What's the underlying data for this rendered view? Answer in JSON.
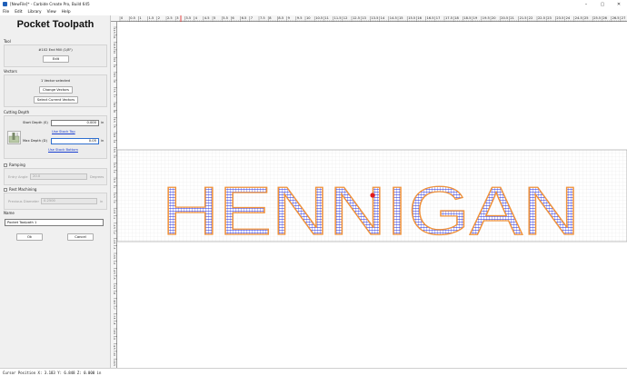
{
  "window": {
    "title": "[NewFile]* - Carbide Create Pro, Build 645",
    "controls": [
      "–",
      "▢",
      "✕"
    ]
  },
  "menu": [
    "File",
    "Edit",
    "Library",
    "View",
    "Help"
  ],
  "panel": {
    "title": "Pocket Toolpath",
    "tool": {
      "label": "Tool",
      "name": "#102 End Mill (1/8\")",
      "edit_button": "Edit"
    },
    "vectors": {
      "label": "Vectors",
      "status": "1 Vector selected",
      "change_button": "Change Vectors",
      "select_button": "Select Current Vectors"
    },
    "cutting_depth": {
      "label": "Cutting Depth",
      "start_label": "Start Depth (S)",
      "start_value": "0.000",
      "start_unit": "in",
      "use_stock_top": "Use Stock Top",
      "max_label": "Max Depth (D)",
      "max_value": "0.05",
      "max_unit": "in",
      "use_stock_bottom": "Use Stock Bottom"
    },
    "ramping": {
      "label": "Ramping",
      "checked": false,
      "entry_angle_label": "Entry Angle",
      "entry_angle_value": "20.0",
      "entry_angle_unit": "Degrees"
    },
    "rest_machining": {
      "label": "Rest Machining",
      "checked": false,
      "prev_diameter_label": "Previous Diameter",
      "prev_diameter_value": "0.2500",
      "prev_diameter_unit": "in"
    },
    "name": {
      "label": "Name",
      "value": "Pocket Toolpath 1"
    },
    "ok_button": "Ok",
    "cancel_button": "Cancel"
  },
  "ruler": {
    "h_labels": [
      "0",
      "0.5",
      "1",
      "1.5",
      "2",
      "2.5",
      "3",
      "3.5",
      "4",
      "4.5",
      "5",
      "5.5",
      "6",
      "6.5",
      "7",
      "7.5",
      "8",
      "8.5",
      "9",
      "9.5",
      "10",
      "10.5",
      "11",
      "11.5",
      "12",
      "12.5",
      "13",
      "13.5",
      "14",
      "14.5",
      "15",
      "15.5",
      "16",
      "16.5",
      "17",
      "17.5",
      "18",
      "18.5",
      "19",
      "19.5",
      "20",
      "20.5",
      "21",
      "21.5",
      "22",
      "22.5",
      "23",
      "23.5",
      "24",
      "24.5",
      "25",
      "25.5",
      "26",
      "26.5",
      "27"
    ],
    "v_labels": [
      "11.5",
      "11",
      "10.5",
      "10",
      "9.5",
      "9",
      "8.5",
      "8",
      "7.5",
      "7",
      "6.5",
      "6",
      "5.5",
      "5",
      "4.5",
      "4",
      "3.5",
      "3",
      "2.5",
      "2",
      "1.5",
      "1",
      "0.5",
      "0",
      "-0.5",
      "-1",
      "-1.5",
      "-2",
      "-2.5",
      "-3",
      "-3.5",
      "-4",
      "-4.5",
      "-5",
      "-5.5",
      "-6",
      "-6.5",
      "-7",
      "-7.5",
      "-8",
      "-8.5",
      "-9",
      "-9.5",
      "-10",
      "-10.5"
    ]
  },
  "design": {
    "text": "HENNIGAN",
    "outline_color": "#f0923a",
    "fill_color": "#3b44e0",
    "grid_color": "#dcdcdc",
    "origin_marker_color": "#e21b1b"
  },
  "status": "Cursor Position X: 3.183 Y: 6.848 Z: 0.000 in"
}
